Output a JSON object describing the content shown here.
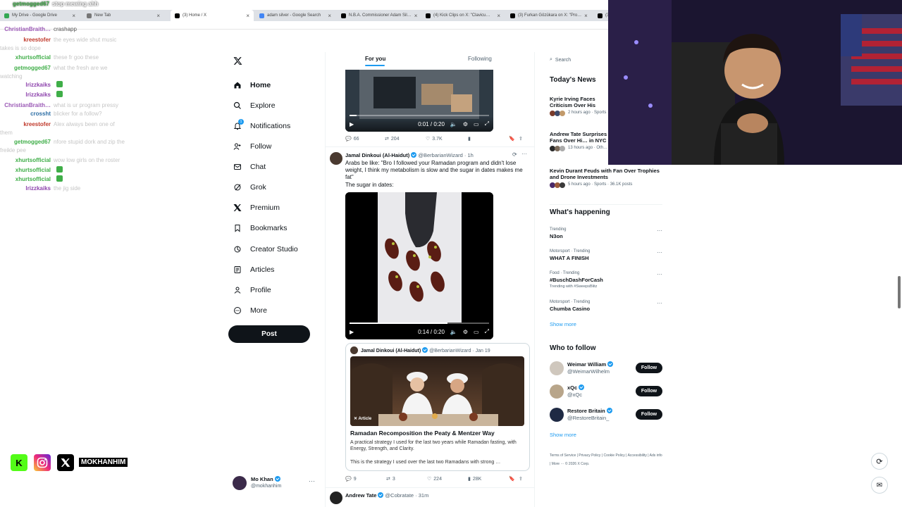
{
  "browser": {
    "tabs": [
      {
        "title": "My Drive - Google Drive",
        "color": "#34a853"
      },
      {
        "title": "New Tab",
        "color": "#777777"
      },
      {
        "title": "(3) Home / X",
        "color": "#000000"
      },
      {
        "title": "adam silver - Google Search",
        "color": "#4285f4"
      },
      {
        "title": "N.B.A. Commissioner Adam Sil…",
        "color": "#000000"
      },
      {
        "title": "(4) Kick Clips on X: \"Clavicu…",
        "color": "#000000"
      },
      {
        "title": "(3) Furkan Gözükara on X: \"Pro…",
        "color": "#000000"
      },
      {
        "title": "(3)",
        "color": "#000000"
      }
    ]
  },
  "chat": {
    "messages": [
      {
        "user": "getmogged67",
        "text": "stop mewing ahh",
        "color": "#3fae48",
        "text_color": "#ffffff"
      },
      {
        "user": "ChristianBraith…",
        "text": "crashapp",
        "color": "#9b59b6",
        "text_color": "#555555"
      },
      {
        "user": "kreestofer",
        "text": "the eyes wide shut music takes is so dope",
        "color": "#c0392b",
        "text_color": "#c6c6c6"
      },
      {
        "user": "xhurtsofficial",
        "text": "these fr goo these",
        "color": "#3fae48",
        "text_color": "#c6c6c6"
      },
      {
        "user": "getmogged67",
        "text": "what the fresh are we watching",
        "color": "#3fae48",
        "text_color": "#c6c6c6"
      },
      {
        "user": "lrizzkaiks",
        "text": "",
        "color": "#8e44ad",
        "text_color": "#c6c6c6"
      },
      {
        "user": "lrizzkaiks",
        "text": "",
        "color": "#8e44ad",
        "text_color": "#c6c6c6"
      },
      {
        "user": "ChristianBraith…",
        "text": "what is ur program pressy",
        "color": "#9b59b6",
        "text_color": "#c6c6c6"
      },
      {
        "user": "crossht",
        "text": "blicker for a follow?",
        "color": "#2c6ea5",
        "text_color": "#c6c6c6"
      },
      {
        "user": "kreestofer",
        "text": "Alex always been one of them",
        "color": "#c0392b",
        "text_color": "#c6c6c6"
      },
      {
        "user": "getmogged67",
        "text": "nfore stupid dork and zip the freikle pee",
        "color": "#3fae48",
        "text_color": "#c6c6c6"
      },
      {
        "user": "xhurtsofficial",
        "text": "wow low girls on the roster",
        "color": "#3fae48",
        "text_color": "#c6c6c6"
      },
      {
        "user": "xhurtsofficial",
        "text": "",
        "color": "#3fae48",
        "text_color": "#c6c6c6"
      },
      {
        "user": "xhurtsofficial",
        "text": "",
        "color": "#3fae48",
        "text_color": "#c6c6c6"
      },
      {
        "user": "lrizzkaiks",
        "text": "the jig side",
        "color": "#8e44ad",
        "text_color": "#c6c6c6"
      }
    ]
  },
  "nav": {
    "items": [
      {
        "label": "Home",
        "icon": "home-icon"
      },
      {
        "label": "Explore",
        "icon": "search-icon"
      },
      {
        "label": "Notifications",
        "icon": "bell-icon"
      },
      {
        "label": "Follow",
        "icon": "person-add-icon"
      },
      {
        "label": "Chat",
        "icon": "mail-icon"
      },
      {
        "label": "Grok",
        "icon": "grok-icon"
      },
      {
        "label": "Premium",
        "icon": "x-icon"
      },
      {
        "label": "Bookmarks",
        "icon": "bookmark-icon"
      },
      {
        "label": "Creator Studio",
        "icon": "studio-icon"
      },
      {
        "label": "Articles",
        "icon": "articles-icon"
      },
      {
        "label": "Profile",
        "icon": "profile-icon"
      },
      {
        "label": "More",
        "icon": "more-icon"
      }
    ],
    "post_label": "Post",
    "notification_count": "1"
  },
  "account": {
    "name": "Mo Khan",
    "handle": "@mokhanhim"
  },
  "feed": {
    "tabs": [
      "For you",
      "Following"
    ],
    "video1": {
      "time": "0:01 / 0:20",
      "progress": 0.05
    },
    "video1_stats": {
      "replies": "66",
      "reposts": "204",
      "likes": "3.7K"
    },
    "tweet2": {
      "name": "Jamal Dinkoui (Al-Haidut)",
      "handle": "@BerbarianWizard · 1h",
      "text": "Arabs be like: \"Bro I followed your Ramadan program and didn't lose weight, I think my metabolism is slow and the sugar in dates makes me fat\"",
      "text2": "The sugar in dates:",
      "video_time": "0:14 / 0:20",
      "video_progress": 0.7
    },
    "quote": {
      "name": "Jamal Dinkoui (Al-Haidut)",
      "handle": "@BerbarianWizard · Jan 19",
      "badge": "Article",
      "title": "Ramadan Recomposition the Peaty & Mentzer Way",
      "desc": "A practical strategy I used for the last two years while Ramadan fasting, with Energy, Strength, and Clarity.",
      "desc2": "This is the strategy I used over the last two Ramadans with strong …"
    },
    "tweet2_stats": {
      "replies": "9",
      "reposts": "3",
      "likes": "224",
      "views": "28K"
    },
    "tweet3": {
      "name": "Andrew Tate",
      "handle": "@Cobratate · 31m"
    }
  },
  "right": {
    "search_placeholder": "Search",
    "news_title": "Today's News",
    "news": [
      {
        "title": "Kyrie Irving Faces Criticism Over His Support for Pa…",
        "meta": "2 hours ago · Sports"
      },
      {
        "title": "Andrew Tate Surprises Fans Over Hi… in NYC Gym",
        "meta": "13 hours ago · Oth…"
      },
      {
        "title": "Kevin Durant Feuds with Fan Over Trophies and Drone Investments",
        "meta": "5 hours ago · Sports · 36.1K posts"
      }
    ],
    "happening_title": "What's happening",
    "trends": [
      {
        "context": "Trending",
        "name": "N3on",
        "extra": ""
      },
      {
        "context": "Motorsport · Trending",
        "name": "WHAT A FINISH",
        "extra": ""
      },
      {
        "context": "Food · Trending",
        "name": "#BuschDashForCash",
        "extra": "Trending with #SweepsBlitz"
      },
      {
        "context": "Motorsport · Trending",
        "name": "Chumba Casino",
        "extra": ""
      }
    ],
    "show_more": "Show more",
    "wtf_title": "Who to follow",
    "wtf": [
      {
        "name": "Weimar William",
        "handle": "@WeimarWilhelm",
        "color": "#cfc7bd"
      },
      {
        "name": "xQc",
        "handle": "@xQc",
        "color": "#b8a58a"
      },
      {
        "name": "Restore Britain",
        "handle": "@RestoreBritain_",
        "color": "#1f2a44"
      }
    ],
    "follow_label": "Follow",
    "footer": "Terms of Service  |  Privacy Policy  |  Cookie Policy  |  Accessibility  |  Ads info  |  More ···  © 2026 X Corp."
  },
  "overlay": {
    "channel": "MOKHANHIM",
    "kick_letter": "K"
  }
}
